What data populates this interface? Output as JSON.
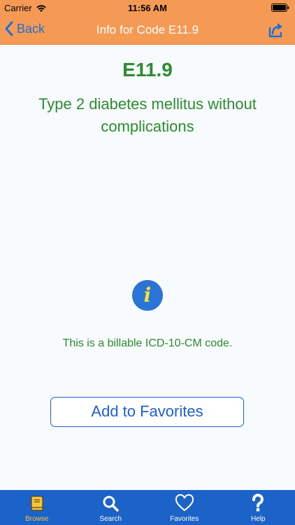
{
  "status": {
    "carrier": "Carrier",
    "time": "11:56 AM"
  },
  "nav": {
    "back_label": "Back",
    "title": "Info for Code E11.9"
  },
  "code": {
    "id": "E11.9",
    "description": "Type 2 diabetes mellitus without complications",
    "billable_text": "This is a billable ICD-10-CM code.",
    "info_glyph": "i"
  },
  "actions": {
    "favorite_label": "Add to Favorites"
  },
  "tabs": [
    {
      "label": "Browse",
      "icon": "book-icon",
      "active": true
    },
    {
      "label": "Search",
      "icon": "search-icon",
      "active": false
    },
    {
      "label": "Favorites",
      "icon": "heart-icon",
      "active": false
    },
    {
      "label": "Help",
      "icon": "question-icon",
      "active": false
    }
  ],
  "colors": {
    "navbar": "#f59a55",
    "accent": "#1c6fd6",
    "code_text": "#2e8b2e",
    "tabbar": "#1b63c8",
    "tab_active": "#f4c63d"
  }
}
